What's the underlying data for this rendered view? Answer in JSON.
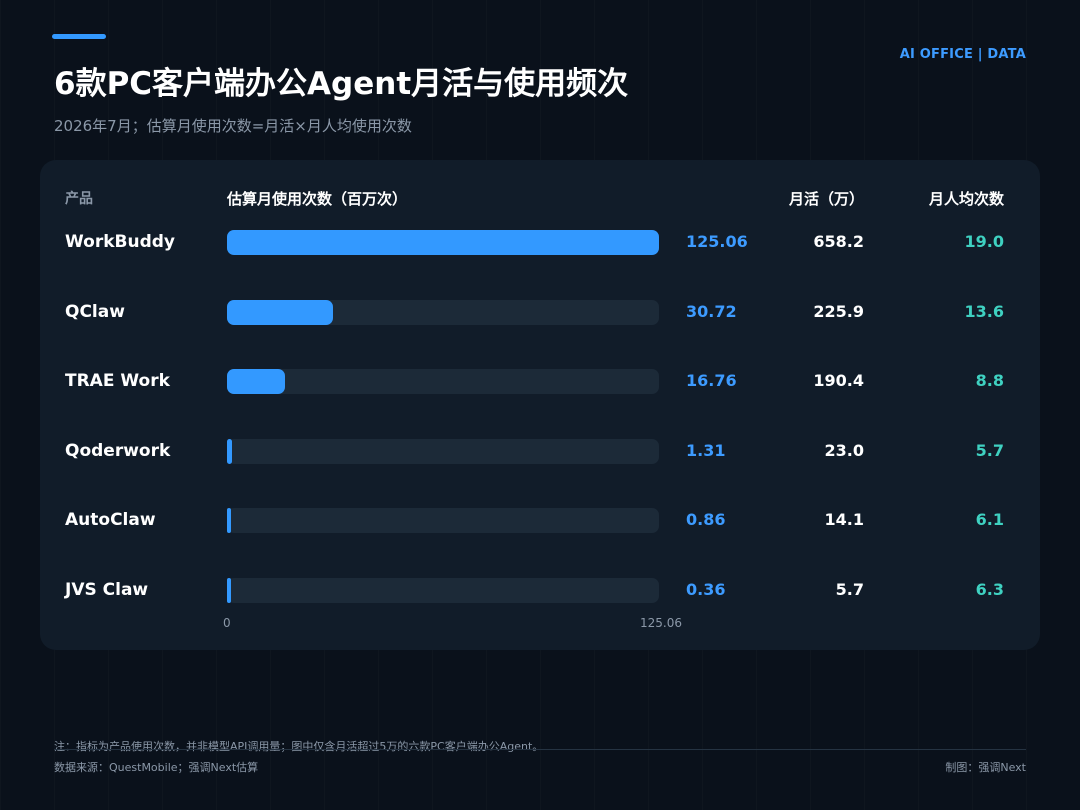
{
  "header": {
    "brand": "AI OFFICE | DATA",
    "title": "6款PC客户端办公Agent月活与使用频次",
    "subtitle": "2026年7月；估算月使用次数=月活×月人均使用次数"
  },
  "table": {
    "col_product": "产品",
    "col_usage": "估算月使用次数（百万次）",
    "col_mau": "月活（万）",
    "col_freq": "月人均次数"
  },
  "chart_data": {
    "type": "bar",
    "orientation": "horizontal",
    "categories": [
      "WorkBuddy",
      "QClaw",
      "TRAE Work",
      "Qoderwork",
      "AutoClaw",
      "JVS Claw"
    ],
    "values": [
      125.06,
      30.72,
      16.76,
      1.31,
      0.86,
      0.36
    ],
    "value_labels": [
      "125.06",
      "30.72",
      "16.76",
      "1.31",
      "0.86",
      "0.36"
    ],
    "mau": [
      "658.2",
      "225.9",
      "190.4",
      "23.0",
      "14.1",
      "5.7"
    ],
    "monthly_freq": [
      "19.0",
      "13.6",
      "8.8",
      "5.7",
      "6.1",
      "6.3"
    ],
    "xlim": [
      0,
      125.06
    ],
    "ticks": [
      "0",
      "125.06"
    ],
    "colors": {
      "bar": "#3399ff",
      "track": "#1c2a38",
      "value": "#3d9bff",
      "freq": "#3fd1c1"
    }
  },
  "footer": {
    "note": "注：指标为产品使用次数，并非模型API调用量；图中仅含月活超过5万的六款PC客户端办公Agent。",
    "source": "数据来源：QuestMobile；强调Next估算",
    "credit": "制图：强调Next"
  }
}
